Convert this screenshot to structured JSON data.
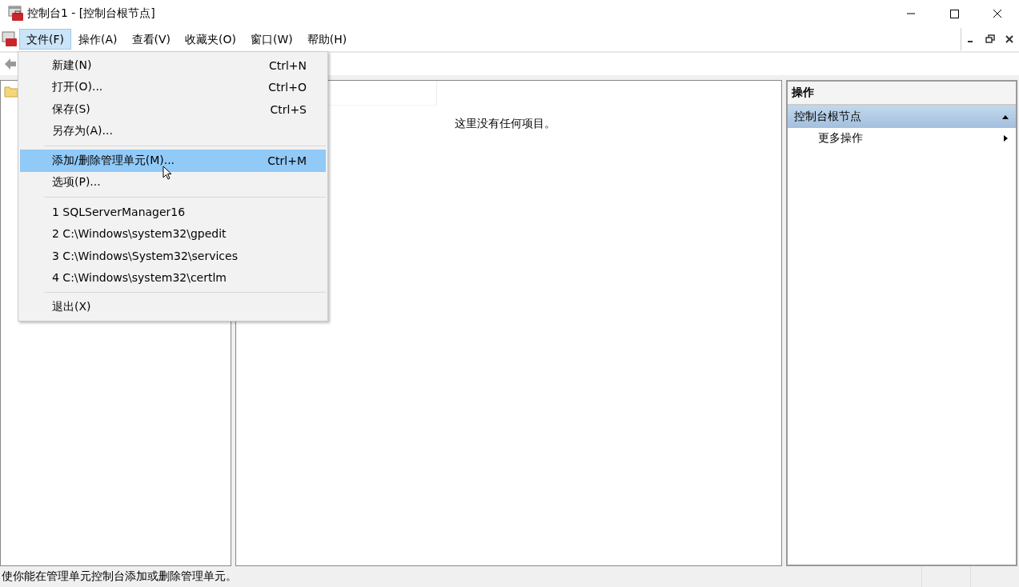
{
  "window": {
    "title": "控制台1 - [控制台根节点]"
  },
  "menubar": [
    {
      "label": "文件(F)",
      "selected": true
    },
    {
      "label": "操作(A)",
      "selected": false
    },
    {
      "label": "查看(V)",
      "selected": false
    },
    {
      "label": "收藏夹(O)",
      "selected": false
    },
    {
      "label": "窗口(W)",
      "selected": false
    },
    {
      "label": "帮助(H)",
      "selected": false
    }
  ],
  "file_menu": [
    {
      "kind": "item",
      "label": "新建(N)",
      "shortcut": "Ctrl+N",
      "selected": false
    },
    {
      "kind": "item",
      "label": "打开(O)...",
      "shortcut": "Ctrl+O",
      "selected": false
    },
    {
      "kind": "item",
      "label": "保存(S)",
      "shortcut": "Ctrl+S",
      "selected": false
    },
    {
      "kind": "item",
      "label": "另存为(A)...",
      "selected": false
    },
    {
      "kind": "separator"
    },
    {
      "kind": "item",
      "label": "添加/删除管理单元(M)...",
      "shortcut": "Ctrl+M",
      "selected": true
    },
    {
      "kind": "item",
      "label": "选项(P)...",
      "selected": false
    },
    {
      "kind": "separator"
    },
    {
      "kind": "item",
      "label": "1 SQLServerManager16",
      "selected": false
    },
    {
      "kind": "item",
      "label": "2 C:\\Windows\\system32\\gpedit",
      "selected": false
    },
    {
      "kind": "item",
      "label": "3 C:\\Windows\\System32\\services",
      "selected": false
    },
    {
      "kind": "item",
      "label": "4 C:\\Windows\\system32\\certlm",
      "selected": false
    },
    {
      "kind": "separator"
    },
    {
      "kind": "item",
      "label": "退出(X)",
      "selected": false
    }
  ],
  "center_pane": {
    "empty_message": "这里没有任何项目。"
  },
  "actions_pane": {
    "header": "操作",
    "section": {
      "title": "控制台根节点",
      "expanded": true,
      "items": [
        {
          "label": "更多操作"
        }
      ]
    }
  },
  "status_bar": {
    "text": "使你能在管理单元控制台添加或删除管理单元。"
  }
}
